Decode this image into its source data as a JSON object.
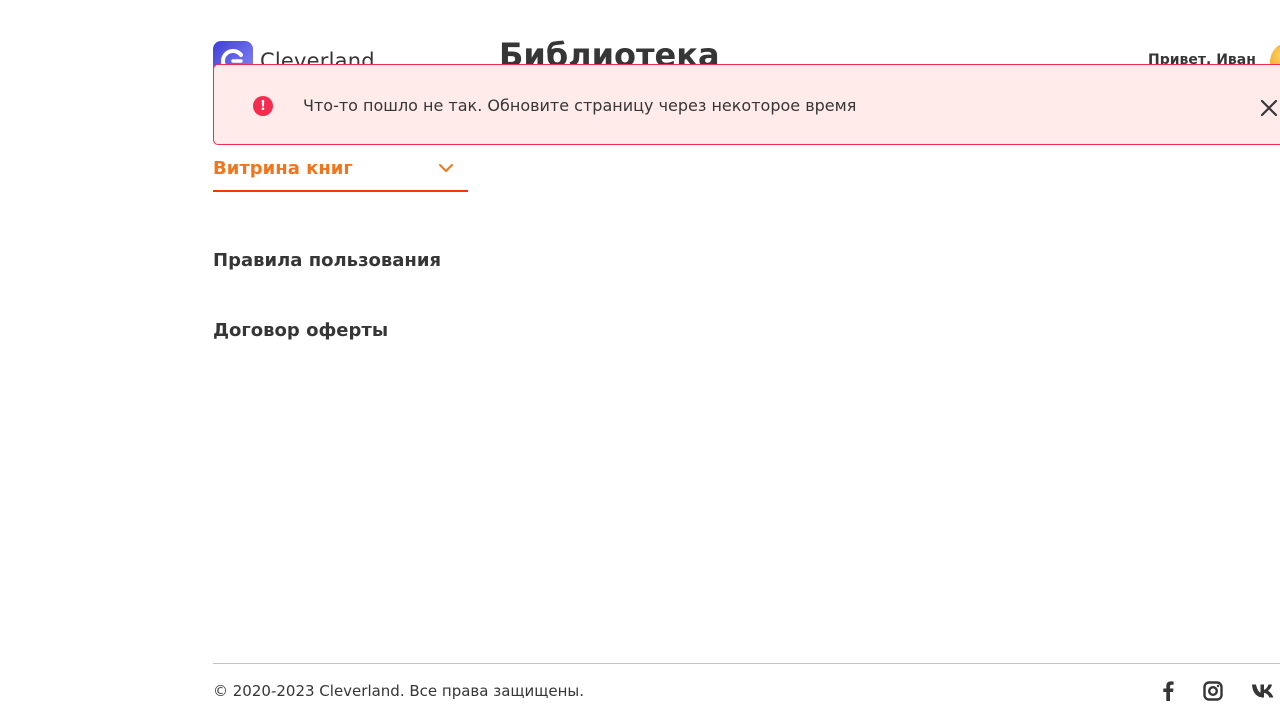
{
  "header": {
    "logo_text": "Cleverland",
    "page_title": "Библиотека",
    "greeting": "Привет, Иван"
  },
  "toast": {
    "message": "Что-то пошло не так. Обновите страницу через некоторое время",
    "icon_glyph": "!"
  },
  "sidebar": {
    "showcase_label": "Витрина книг",
    "rules_label": "Правила пользования",
    "offer_label": "Договор оферты"
  },
  "footer": {
    "copyright": "© 2020-2023 Cleverland. Все права защищены.",
    "social": [
      "facebook-icon",
      "instagram-icon",
      "vk-icon"
    ]
  },
  "colors": {
    "accent": "#f0751d",
    "error": "#f42c4f",
    "error_bg": "#feebea",
    "text": "#363636"
  }
}
